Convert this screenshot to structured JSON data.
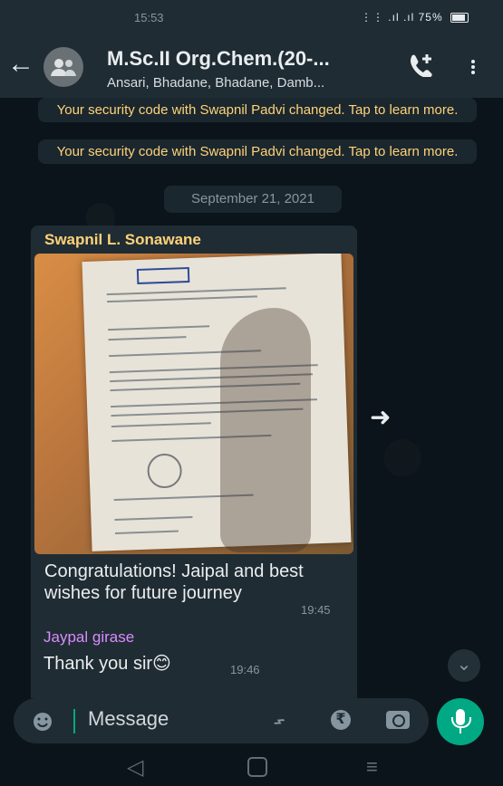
{
  "status": {
    "time": "15:53",
    "icons_text": "⋮⋮ .ıl .ıl",
    "battery": "75%"
  },
  "header": {
    "title": "M.Sc.II Org.Chem.(20-...",
    "subtitle": "Ansari, Bhadane, Bhadane, Damb..."
  },
  "notices": [
    "Your security code with Swapnil Padvi changed. Tap to learn more.",
    "Your security code with Swapnil Padvi changed. Tap to learn more."
  ],
  "date_label": "September 21, 2021",
  "messages": [
    {
      "sender": "Swapnil L. Sonawane",
      "sender_color": "#ffd279",
      "text": "Congratulations! Jaipal and best wishes for future journey",
      "time": "19:45"
    },
    {
      "sender": "Jaypal girase",
      "sender_color": "#d88cff",
      "text": "Thank you sir😊",
      "time": "19:46"
    }
  ],
  "composer": {
    "placeholder": "Message"
  },
  "icons": {
    "back": "arrow-left-icon",
    "avatar": "group-avatar-icon",
    "call": "add-call-icon",
    "menu": "more-vertical-icon",
    "forward": "forward-icon",
    "emoji": "emoji-icon",
    "attach": "attachment-icon",
    "rupee": "payment-icon",
    "camera": "camera-icon",
    "mic": "microphone-icon"
  },
  "colors": {
    "accent": "#00a884",
    "notice_text": "#ffd279",
    "bubble": "#202c33"
  }
}
